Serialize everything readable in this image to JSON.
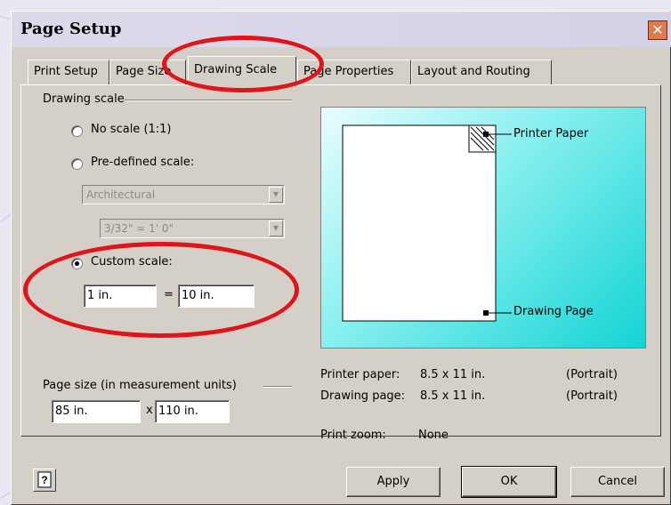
{
  "dialog": {
    "title": "Page Setup",
    "close_glyph": "✕"
  },
  "tabs": [
    {
      "label": "Print Setup",
      "active": false
    },
    {
      "label": "Page Size",
      "active": false
    },
    {
      "label": "Drawing Scale",
      "active": true
    },
    {
      "label": "Page Properties",
      "active": false
    },
    {
      "label": "Layout and Routing",
      "active": false
    }
  ],
  "drawing_scale": {
    "group_label": "Drawing scale",
    "options": [
      {
        "label": "No scale (1:1)",
        "selected": false
      },
      {
        "label": "Pre-defined scale:",
        "selected": false
      },
      {
        "label": "Custom scale:",
        "selected": true
      }
    ],
    "predefined_type": "Architectural",
    "predefined_ratio": "3/32\" = 1' 0\"",
    "custom_left": "1 in.",
    "equals": "=",
    "custom_right": "10 in."
  },
  "page_size": {
    "group_label": "Page size (in measurement units)",
    "width": "85 in.",
    "times": "x",
    "height": "110 in."
  },
  "preview": {
    "printer_label": "Printer Paper",
    "drawing_label": "Drawing Page"
  },
  "info": {
    "printer_paper_label": "Printer paper:",
    "printer_paper_value": "8.5 x 11 in.",
    "printer_paper_orient": "(Portrait)",
    "drawing_page_label": "Drawing page:",
    "drawing_page_value": "8.5 x 11 in.",
    "drawing_page_orient": "(Portrait)",
    "zoom_label": "Print zoom:",
    "zoom_value": "None"
  },
  "buttons": {
    "apply": "Apply",
    "ok": "OK",
    "cancel": "Cancel",
    "help_glyph": "?"
  },
  "colors": {
    "annotation": "#e0141a",
    "preview_accent": "#14d4d4",
    "dialog_bg": "#d4d0c8"
  },
  "icons": [
    "close-icon",
    "help-icon",
    "dropdown-arrow-icon"
  ]
}
